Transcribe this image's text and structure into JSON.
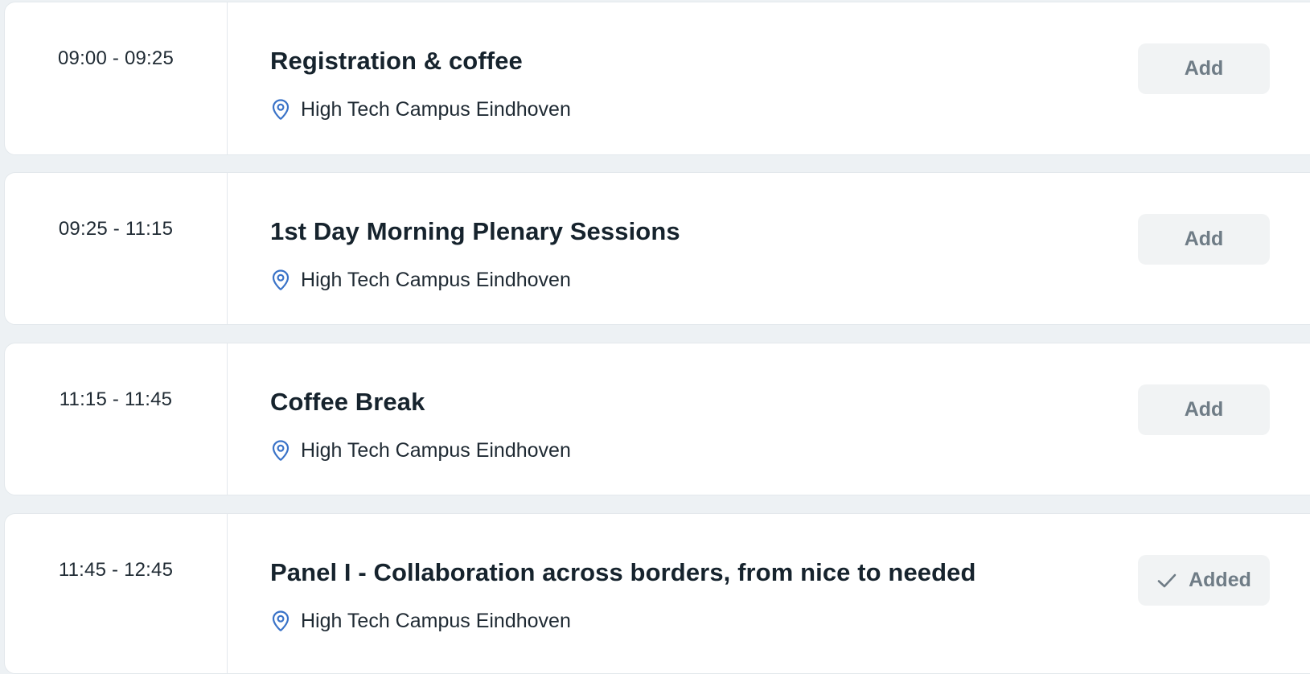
{
  "sessions": [
    {
      "time": "09:00 - 09:25",
      "title": "Registration & coffee",
      "location": "High Tech Campus Eindhoven",
      "button_label": "Add",
      "added": false
    },
    {
      "time": "09:25 - 11:15",
      "title": "1st Day Morning Plenary Sessions",
      "location": "High Tech Campus Eindhoven",
      "button_label": "Add",
      "added": false
    },
    {
      "time": "11:15 - 11:45",
      "title": "Coffee Break",
      "location": "High Tech Campus Eindhoven",
      "button_label": "Add",
      "added": false
    },
    {
      "time": "11:45 - 12:45",
      "title": "Panel I - Collaboration across borders, from nice to needed",
      "location": "High Tech Campus Eindhoven",
      "button_label": "Added",
      "added": true
    }
  ],
  "icons": {
    "location": "map-pin-icon",
    "added": "check-icon"
  },
  "colors": {
    "pin": "#3a73c8",
    "button_bg": "#f1f3f4",
    "button_text": "#6f7c86",
    "page_bg": "#edf1f4"
  }
}
